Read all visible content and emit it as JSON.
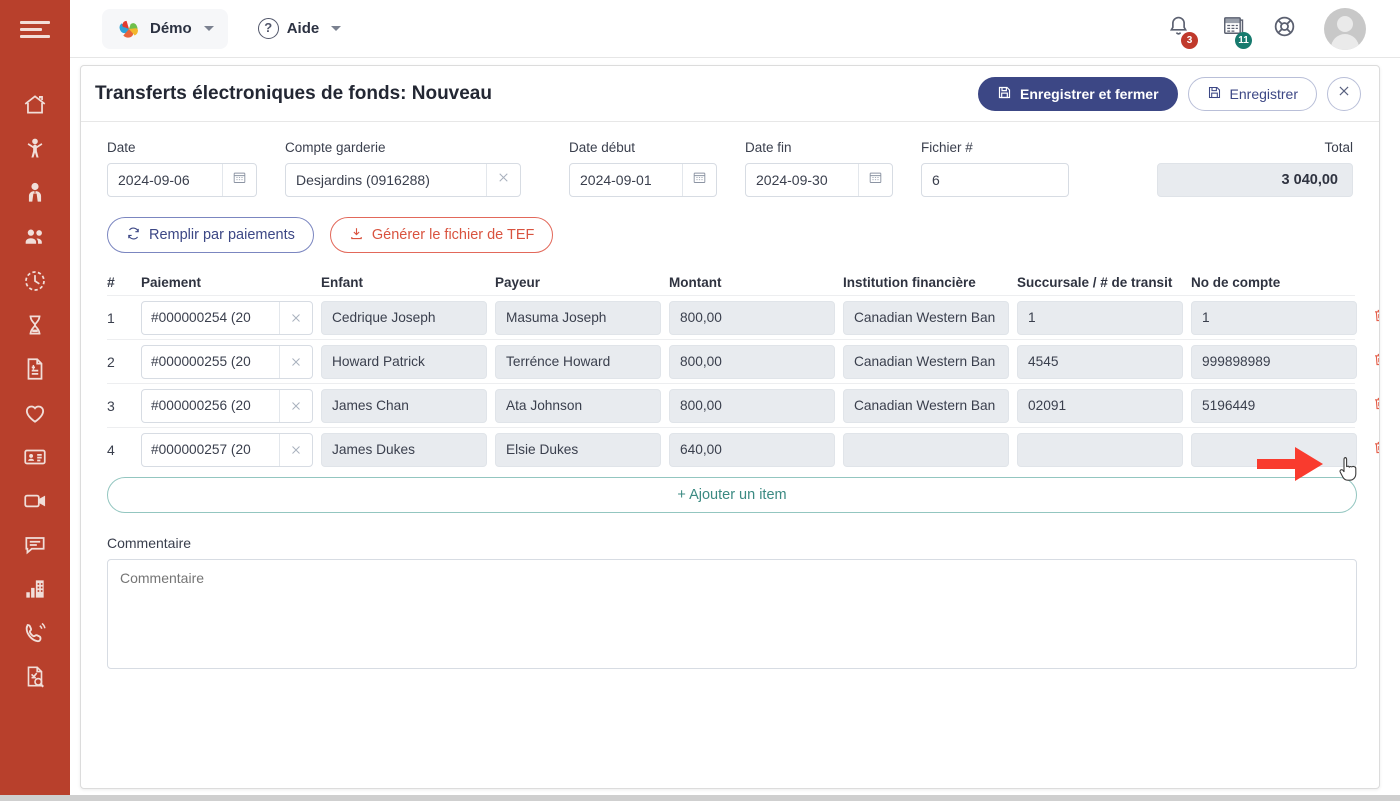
{
  "sidebar": {
    "menu_toggle": "menu-toggle",
    "items": [
      {
        "name": "home",
        "icon": "home-icon"
      },
      {
        "name": "child",
        "icon": "child-icon"
      },
      {
        "name": "employee",
        "icon": "employee-icon"
      },
      {
        "name": "groups",
        "icon": "people-icon"
      },
      {
        "name": "attendance",
        "icon": "clock-icon"
      },
      {
        "name": "waiting-list",
        "icon": "hourglass-icon"
      },
      {
        "name": "billing",
        "icon": "invoice-icon"
      },
      {
        "name": "health",
        "icon": "heart-icon"
      },
      {
        "name": "contacts",
        "icon": "id-card-icon"
      },
      {
        "name": "video",
        "icon": "video-camera-icon"
      },
      {
        "name": "messages",
        "icon": "chat-icon"
      },
      {
        "name": "reports",
        "icon": "bar-chart-building-icon"
      },
      {
        "name": "calls",
        "icon": "phone-ring-icon"
      },
      {
        "name": "audit",
        "icon": "document-search-icon"
      }
    ]
  },
  "topbar": {
    "app_name": "Démo",
    "app_logo_icon": "hands-logo-icon",
    "app_caret_icon": "chevron-down-icon",
    "help_label": "Aide",
    "help_icon": "question-circle-icon",
    "help_caret_icon": "chevron-down-icon",
    "notifications": {
      "icon": "bell-icon",
      "count": "3"
    },
    "tasks": {
      "icon": "calendar-tasks-icon",
      "count": "11"
    },
    "support": {
      "icon": "lifebuoy-icon"
    },
    "avatar": {
      "icon": "user-avatar-icon"
    }
  },
  "page": {
    "title": "Transferts électroniques de fonds: Nouveau",
    "save_and_close_label": "Enregistrer et fermer",
    "save_label": "Enregistrer",
    "save_icon": "floppy-disk-icon",
    "close_icon": "close-x-icon"
  },
  "form": {
    "date": {
      "label": "Date",
      "value": "2024-09-06",
      "icon": "calendar-icon"
    },
    "account": {
      "label": "Compte garderie",
      "value": "Desjardins (0916288)",
      "clear_icon": "close-x-icon"
    },
    "date_start": {
      "label": "Date début",
      "value": "2024-09-01",
      "icon": "calendar-icon"
    },
    "date_end": {
      "label": "Date fin",
      "value": "2024-09-30",
      "icon": "calendar-icon"
    },
    "file_number": {
      "label": "Fichier #",
      "value": "6"
    },
    "total": {
      "label": "Total",
      "value": "3 040,00"
    }
  },
  "actions": {
    "fill_by_payments": {
      "label": "Remplir par paiements",
      "icon": "refresh-icon"
    },
    "generate_eft_file": {
      "label": "Générer le fichier de TEF",
      "icon": "download-icon"
    }
  },
  "table": {
    "headers": [
      "#",
      "Paiement",
      "Enfant",
      "Payeur",
      "Montant",
      "Institution financière",
      "Succursale / # de transit",
      "No de compte"
    ],
    "clear_icon": "close-x-icon",
    "delete_icon": "trash-icon",
    "rows": [
      {
        "index": "1",
        "payment": "#000000254 (20",
        "child": "Cedrique Joseph",
        "payer": "Masuma Joseph",
        "amount": "800,00",
        "institution": "Canadian Western Ban",
        "branch": "1",
        "account": "1"
      },
      {
        "index": "2",
        "payment": "#000000255 (20",
        "child": "Howard Patrick",
        "payer": "Terrénce Howard",
        "amount": "800,00",
        "institution": "Canadian Western Ban",
        "branch": "4545",
        "account": "999898989"
      },
      {
        "index": "3",
        "payment": "#000000256 (20",
        "child": "James Chan",
        "payer": "Ata Johnson",
        "amount": "800,00",
        "institution": "Canadian Western Ban",
        "branch": "02091",
        "account": "5196449"
      },
      {
        "index": "4",
        "payment": "#000000257 (20",
        "child": "James Dukes",
        "payer": "Elsie Dukes",
        "amount": "640,00",
        "institution": "",
        "branch": "",
        "account": ""
      }
    ],
    "add_item_label": "+  Ajouter un item"
  },
  "comment": {
    "label": "Commentaire",
    "placeholder": "Commentaire",
    "value": ""
  },
  "colors": {
    "sidebar": "#b8402c",
    "primary": "#3c4785",
    "danger": "#d9533f",
    "teal": "#3b8a82",
    "badge_red": "#c0392b",
    "badge_teal": "#177a6e",
    "arrow_red": "#f93b2e"
  }
}
